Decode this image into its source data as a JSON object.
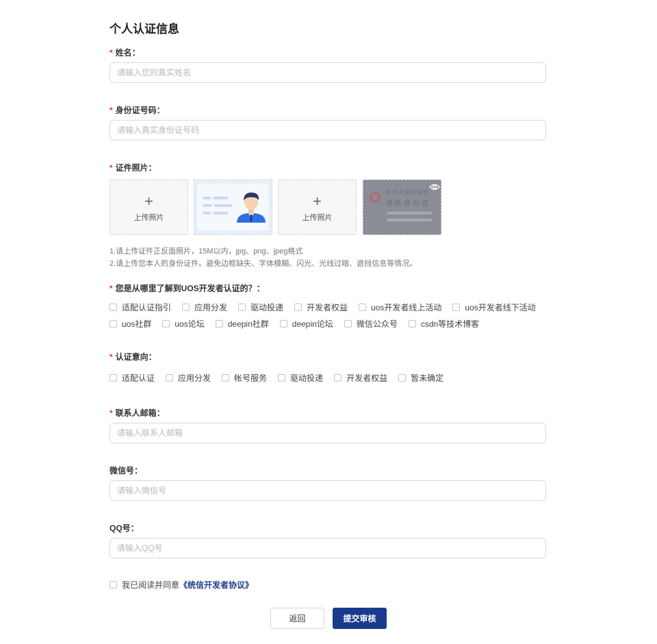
{
  "form": {
    "title": "个人认证信息",
    "required_mark": "*",
    "name": {
      "label": "姓名：",
      "placeholder": "请输入您的真实姓名"
    },
    "id_number": {
      "label": "身份证号码：",
      "placeholder": "请输入真实身份证号码"
    },
    "photos": {
      "label": "证件照片：",
      "upload_plus": "+",
      "upload_text": "上传照片",
      "sample_front_alt": "身份证正面示例",
      "sample_back_title1": "中华人民共和国",
      "sample_back_title2": "居民身份证",
      "hints": [
        "1.请上传证件正反面照片，15M以内，jpg、png、jpeg格式",
        "2.请上传您本人的身份证件。避免边框缺失、字体模糊、闪光、光线过暗、遮挡信息等情况。"
      ]
    },
    "source": {
      "label": "您是从哪里了解到UOS开发者认证的？：",
      "options_row1": [
        "适配认证指引",
        "应用分发",
        "驱动投递",
        "开发者权益",
        "uos开发者线上活动",
        "uos开发者线下活动"
      ],
      "options_row2": [
        "uos社群",
        "uos论坛",
        "deepin社群",
        "deepin论坛",
        "微信公众号",
        "csdn等技术博客"
      ]
    },
    "intent": {
      "label": "认证意向：",
      "options": [
        "适配认证",
        "应用分发",
        "帐号服务",
        "驱动投递",
        "开发者权益",
        "暂未确定"
      ]
    },
    "email": {
      "label": "联系人邮箱：",
      "placeholder": "请输入联系人邮箱"
    },
    "wechat": {
      "label": "微信号：",
      "placeholder": "请输入微信号"
    },
    "qq": {
      "label": "QQ号：",
      "placeholder": "请输入QQ号"
    },
    "agreement": {
      "text": "我已阅读并同意",
      "link": "《统信开发者协议》"
    },
    "buttons": {
      "back": "返回",
      "submit": "提交审核"
    }
  },
  "colors": {
    "primary": "#1a3a8f",
    "required": "#e53935",
    "link": "#1e3c8c"
  },
  "icons": {
    "upload": "plus-icon",
    "preview": "eye-icon"
  }
}
